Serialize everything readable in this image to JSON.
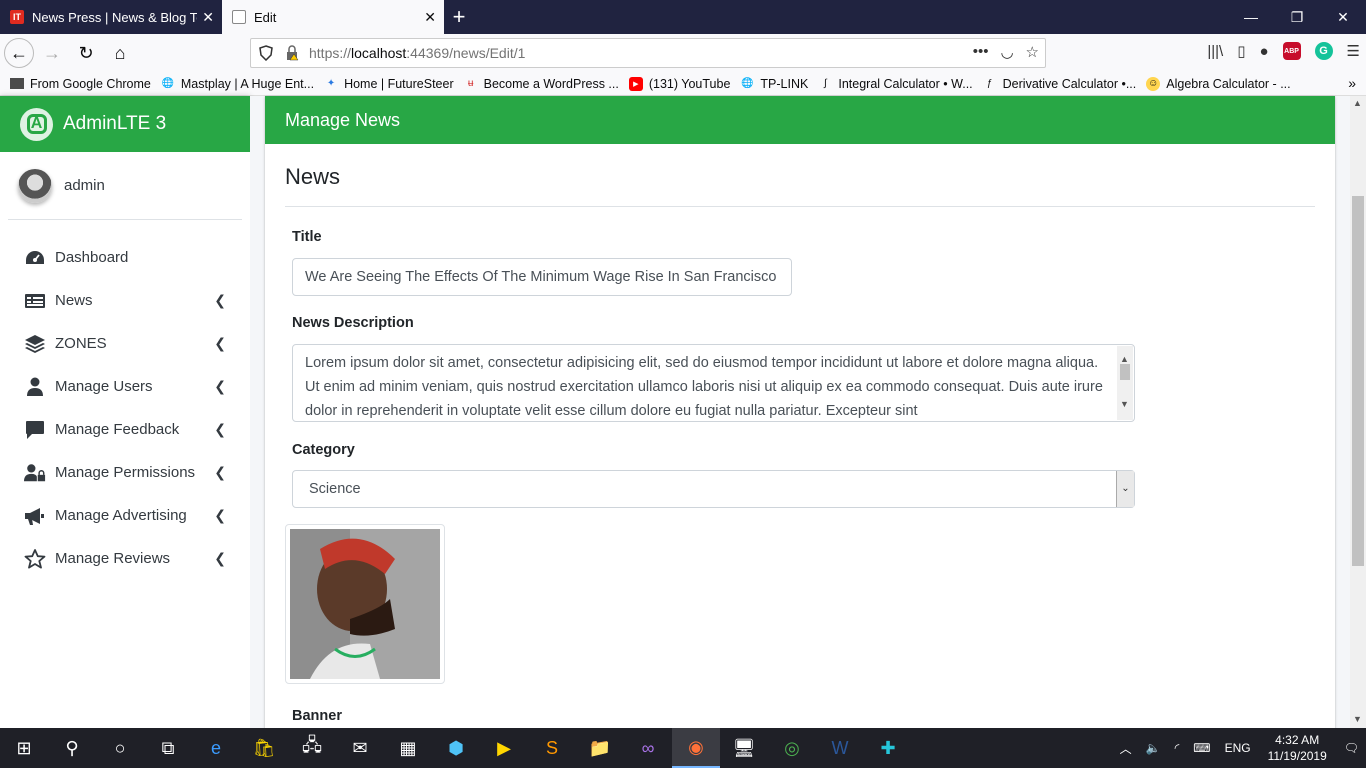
{
  "browser": {
    "tabs": [
      {
        "label": "News Press | News & Blog Tem",
        "active": false
      },
      {
        "label": "Edit",
        "active": true
      }
    ],
    "url": {
      "protocol": "https://",
      "host": "localhost",
      "path": ":44369/news/Edit/1"
    },
    "bookmarks": [
      "From Google Chrome",
      "Mastplay | A Huge Ent...",
      "Home | FutureSteer",
      "Become a WordPress ...",
      "(131) YouTube",
      "TP-LINK",
      "Integral Calculator • W...",
      "Derivative Calculator •...",
      "Algebra Calculator - ..."
    ]
  },
  "sidebar": {
    "brand": "AdminLTE 3",
    "user": "admin",
    "items": [
      {
        "label": "Dashboard",
        "icon": "dashboard-icon",
        "has_children": false
      },
      {
        "label": "News",
        "icon": "news-icon",
        "has_children": true
      },
      {
        "label": "ZONES",
        "icon": "layers-icon",
        "has_children": true
      },
      {
        "label": "Manage Users",
        "icon": "user-icon",
        "has_children": true
      },
      {
        "label": "Manage Feedback",
        "icon": "comment-icon",
        "has_children": true
      },
      {
        "label": "Manage Permissions",
        "icon": "users-lock-icon",
        "has_children": true
      },
      {
        "label": "Manage Advertising",
        "icon": "megaphone-icon",
        "has_children": true
      },
      {
        "label": "Manage Reviews",
        "icon": "star-icon",
        "has_children": true
      }
    ]
  },
  "card": {
    "header": "Manage News",
    "section_title": "News",
    "title_label": "Title",
    "title_value": "We Are Seeing The Effects Of The Minimum Wage Rise In San Francisco",
    "desc_label": "News Description",
    "desc_value": "Lorem ipsum dolor sit amet, consectetur adipisicing elit, sed do eiusmod tempor incididunt ut labore et dolore magna aliqua. Ut enim ad minim veniam, quis nostrud exercitation ullamco laboris nisi ut aliquip ex ea commodo consequat. Duis aute irure dolor in reprehenderit in voluptate velit esse cillum dolore eu fugiat nulla pariatur. Excepteur sint",
    "category_label": "Category",
    "category_value": "Science",
    "banner_label": "Banner"
  },
  "taskbar": {
    "lang": "ENG",
    "time": "4:32 AM",
    "date": "11/19/2019"
  },
  "colors": {
    "accent": "#28a745",
    "tabbar": "#202340",
    "taskbar": "#1f2027"
  }
}
